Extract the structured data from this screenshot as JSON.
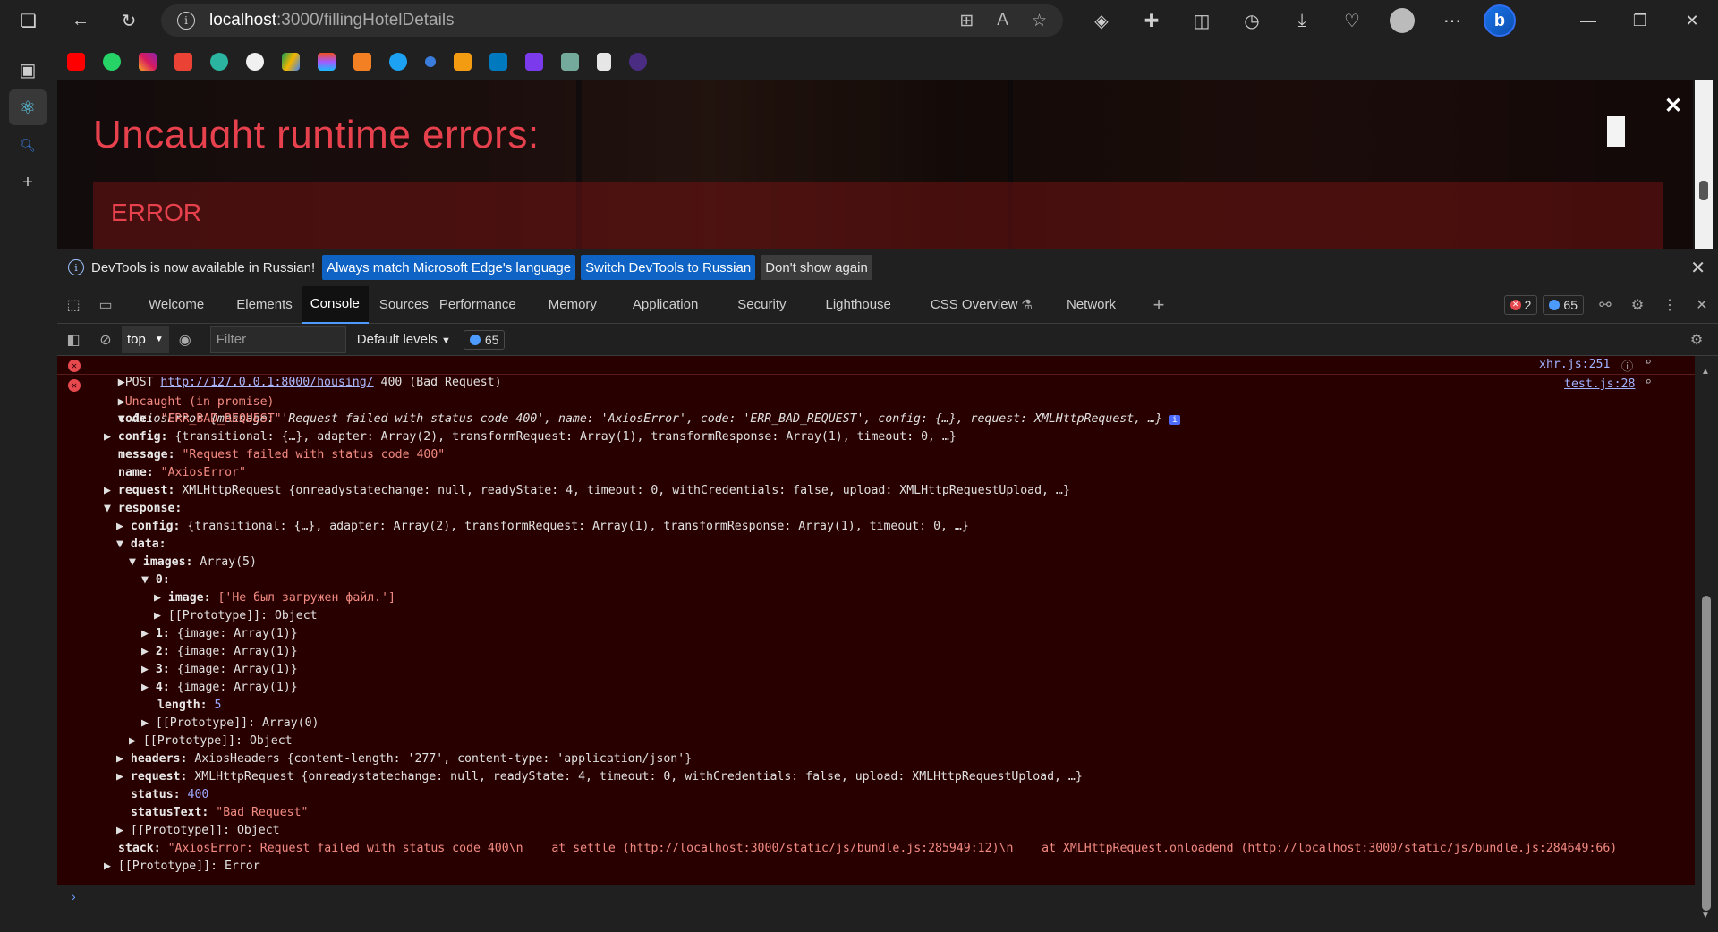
{
  "browser": {
    "url_host": "localhost",
    "url_path": ":3000/fillingHotelDetails"
  },
  "page": {
    "error_title": "Uncaught runtime errors:",
    "error_label": "ERROR"
  },
  "infobar": {
    "message": "DevTools is now available in Russian!",
    "btn_match": "Always match Microsoft Edge's language",
    "btn_switch": "Switch DevTools to Russian",
    "btn_dismiss": "Don't show again"
  },
  "tabs": [
    "Welcome",
    "Elements",
    "Console",
    "Sources",
    "Performance",
    "Memory",
    "Application",
    "Security",
    "Lighthouse",
    "CSS Overview",
    "Network"
  ],
  "counts": {
    "errors": "2",
    "messages": "65"
  },
  "toolbar": {
    "context": "top",
    "filter_placeholder": "Filter",
    "levels": "Default levels",
    "messages": "65"
  },
  "console": {
    "post_prefix": "POST ",
    "post_url": "http://127.0.0.1:8000/housing/",
    "post_suffix": " 400 (Bad Request)",
    "post_src": "xhr.js:251",
    "uncaught": "Uncaught (in promise)",
    "uncaught_src": "test.js:28",
    "axios_summary": "AxiosError {message: 'Request failed with status code 400', name: 'AxiosError', code: 'ERR_BAD_REQUEST', config: {…}, request: XMLHttpRequest, …}",
    "code": "\"ERR_BAD_REQUEST\"",
    "config": "{transitional: {…}, adapter: Array(2), transformRequest: Array(1), transformResponse: Array(1), timeout: 0, …}",
    "message": "\"Request failed with status code 400\"",
    "name": "\"AxiosError\"",
    "request": "XMLHttpRequest {onreadystatechange: null, readyState: 4, timeout: 0, withCredentials: false, upload: XMLHttpRequestUpload, …}",
    "image0": "['Не был загружен файл.']",
    "headers": "AxiosHeaders {content-length: '277', content-type: 'application/json'}",
    "status": "400",
    "statusText": "\"Bad Request\"",
    "stack": "\"AxiosError: Request failed with status code 400\\n    at settle (http://localhost:3000/static/js/bundle.js:285949:12)\\n    at XMLHttpRequest.onloadend (http://localhost:3000/static/js/bundle.js:284649:66)"
  }
}
